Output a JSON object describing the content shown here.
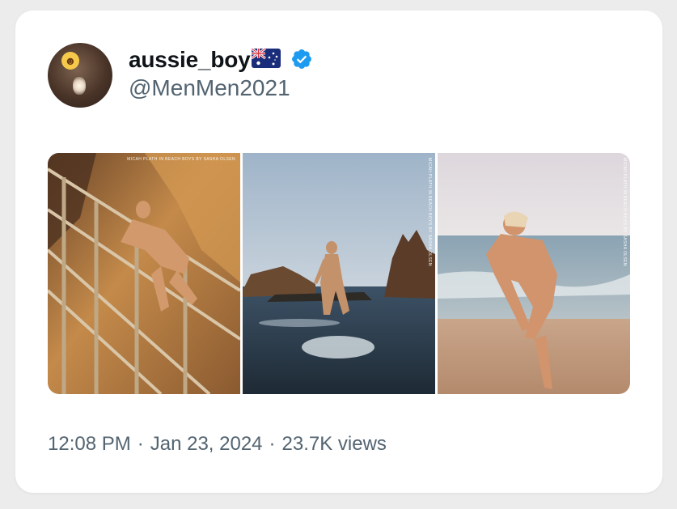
{
  "tweet": {
    "display_name": "aussie_boy",
    "flag": "australia-flag",
    "verified": true,
    "handle": "@MenMen2021",
    "avatar_icon": "sticker-face-icon",
    "time": "12:08 PM",
    "separator": "·",
    "date": "Jan 23, 2024",
    "views": "23.7K views"
  },
  "media": {
    "photos": [
      {
        "credit": "MICAH PLATH IN BEACH BOYS BY SASHA OLSEN",
        "scene": "staircase"
      },
      {
        "credit": "MICAH PLATH IN BEACH BOYS BY SASHA OLSEN",
        "scene": "sea-rocks"
      },
      {
        "credit": "MICAH PLATH IN BEACH BOYS BY SASHA OLSEN",
        "scene": "beach"
      }
    ]
  },
  "colors": {
    "background": "#ececec",
    "card": "#ffffff",
    "name": "#0f1419",
    "secondary_text": "#536471",
    "verified": "#1d9bf0"
  }
}
